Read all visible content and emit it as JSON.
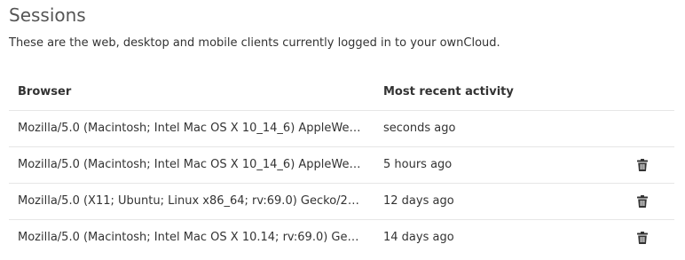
{
  "section": {
    "title": "Sessions",
    "description": "These are the web, desktop and mobile clients currently logged in to your ownCloud."
  },
  "table": {
    "headers": {
      "browser": "Browser",
      "activity": "Most recent activity"
    },
    "rows": [
      {
        "browser": "Mozilla/5.0 (Macintosh; Intel Mac OS X 10_14_6) AppleWebKit/6...",
        "activity": "seconds ago",
        "deletable": false
      },
      {
        "browser": "Mozilla/5.0 (Macintosh; Intel Mac OS X 10_14_6) AppleWebKit/6...",
        "activity": "5 hours ago",
        "deletable": true
      },
      {
        "browser": "Mozilla/5.0 (X11; Ubuntu; Linux x86_64; rv:69.0) Gecko/201001...",
        "activity": "12 days ago",
        "deletable": true
      },
      {
        "browser": "Mozilla/5.0 (Macintosh; Intel Mac OS X 10.14; rv:69.0) Gecko/20...",
        "activity": "14 days ago",
        "deletable": true
      }
    ]
  },
  "icons": {
    "delete": "trash-icon"
  },
  "colors": {
    "text": "#333333",
    "title": "#555555",
    "divider": "#e6e6e6",
    "icon": "#333333"
  }
}
